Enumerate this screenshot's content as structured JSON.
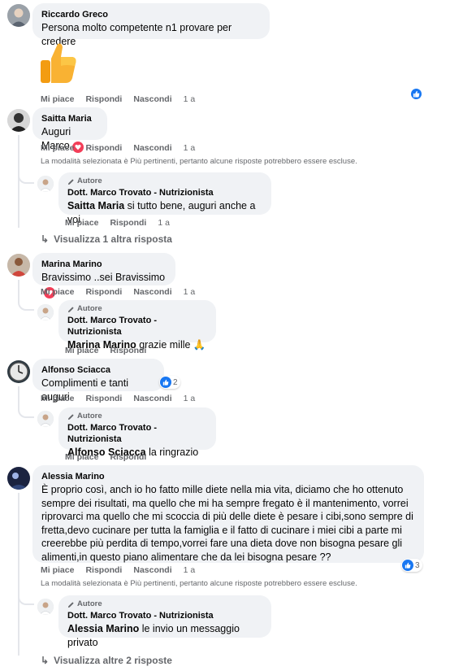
{
  "colors": {
    "bubble": "#f0f2f5",
    "meta": "#65676b",
    "like_blue": "#1877f2",
    "love_red": "#f33e58"
  },
  "actions": {
    "like": "Mi piace",
    "reply": "Rispondi",
    "hide": "Nascondi",
    "time": "1 a"
  },
  "filter_note": "La modalità selezionata è Più pertinenti, pertanto alcune risposte potrebbero essere escluse.",
  "author_badge": "Autore",
  "comments": [
    {
      "author": "Riccardo Greco",
      "text": "Persona molto competente n1 provare per credere",
      "sticker": "thumbs-up",
      "reaction": "like"
    },
    {
      "author": "Saitta Maria",
      "text": "Auguri Marco",
      "reaction": "love",
      "reply": {
        "author": "Dott. Marco Trovato - Nutrizionista",
        "mention": "Saitta Maria",
        "text": "si tutto bene, auguri anche a voi"
      },
      "more_replies": "Visualizza 1 altra risposta"
    },
    {
      "author": "Marina Marino",
      "text": "Bravissimo ..sei Bravissimo",
      "reaction": "love",
      "reply": {
        "author": "Dott. Marco Trovato - Nutrizionista",
        "mention": "Marina Marino",
        "text": "grazie mille 🙏"
      }
    },
    {
      "author": "Alfonso Sciacca",
      "text": "Complimenti e tanti auguri",
      "reaction": "like",
      "reaction_count": "2",
      "reply": {
        "author": "Dott. Marco Trovato - Nutrizionista",
        "mention": "Alfonso Sciacca",
        "text": "la ringrazio"
      }
    },
    {
      "author": "Alessia Marino",
      "lines": [
        "È proprio così, anch io ho fatto mille diete nella mia vita, diciamo che ho ottenuto",
        "sempre dei risultati, ma quello che mi ha sempre fregato è il mantenimento, vorrei",
        "riprovarci ma quello che mi scoccia di più delle diete è pesare i cibi,sono sempre di",
        "fretta,devo cucinare per tutta la famiglia e il fatto di cucinare i miei cibi a parte mi",
        "creerebbe più perdita di tempo,vorrei fare una dieta dove non bisogna pesare gli",
        "alimenti,in questo piano alimentare che da lei bisogna pesare ??"
      ],
      "reaction": "like",
      "reaction_count": "3",
      "reply": {
        "author": "Dott. Marco Trovato - Nutrizionista",
        "mention": "Alessia Marino",
        "text": "le invio un messaggio privato"
      },
      "more_replies": "Visualizza altre 2 risposte"
    }
  ]
}
